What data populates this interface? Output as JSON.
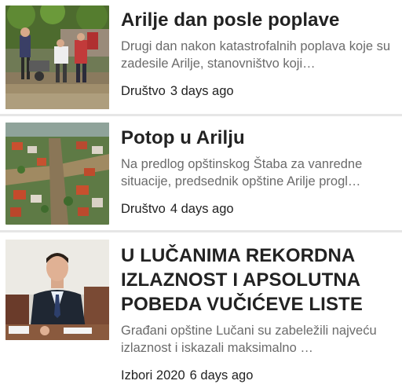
{
  "articles": [
    {
      "title": "Arilje dan posle poplave",
      "excerpt": "Drugi dan nakon katastrofalnih poplava koje su zadesile Arilje, stanovništvo koji…",
      "category": "Društvo",
      "time": "3 days ago",
      "image_icon": "flood-cleanup-photo"
    },
    {
      "title": "Potop u Arilju",
      "excerpt": "Na predlog opštinskog Štaba za vanredne situacije, predsednik opštine Arilje progl…",
      "category": "Društvo",
      "time": "4 days ago",
      "image_icon": "aerial-flood-photo"
    },
    {
      "title": "U LUČANIMA REKORDNA IZLAZNOST I APSOLUTNA POBEDA VUČIĆEVE LISTE",
      "excerpt": "Građani opštine Lučani su zabeležili najveću izlaznost i iskazali maksimalno …",
      "category": "Izbori 2020",
      "time": "6 days ago",
      "image_icon": "official-portrait-photo"
    }
  ]
}
